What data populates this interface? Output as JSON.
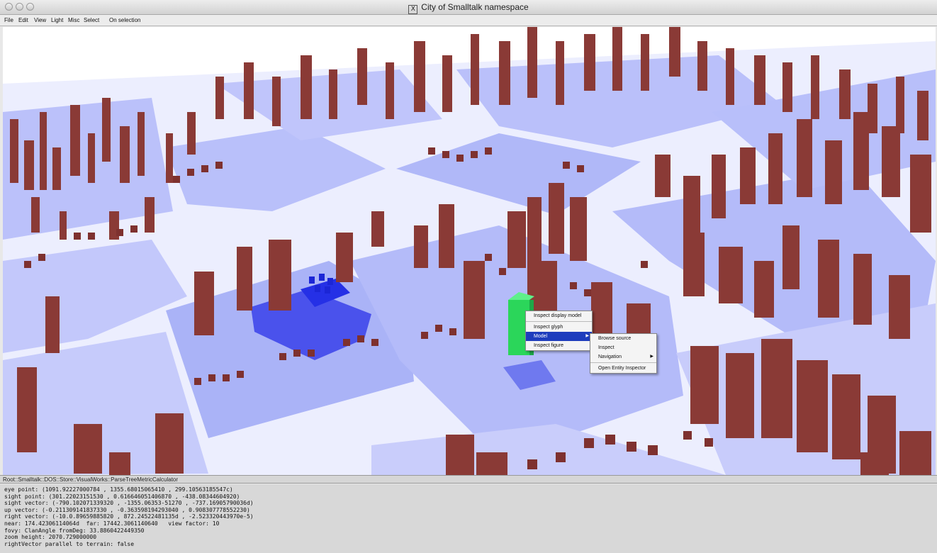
{
  "window": {
    "title": "City of Smalltalk namespace"
  },
  "menubar": [
    "File",
    "Edit",
    "View",
    "Light",
    "Misc",
    "Select",
    "On selection"
  ],
  "colors": {
    "class_building": "#8a3a36",
    "package_district": "#a9b1f5",
    "selected_building": "#2bd65a",
    "selected_district": "#2e35ea",
    "menu_highlight": "#1e3dbd"
  },
  "context_menu": {
    "items": [
      "Inspect display model",
      "Inspect glyph",
      "Model",
      "Inspect figure"
    ],
    "highlighted": "Model"
  },
  "submenu": {
    "items": [
      "Browse source",
      "Inspect",
      "Navigation",
      "Open Entity Inspector"
    ]
  },
  "status_path": "Root::Smalltalk::DOS::Store::VisualWorks::ParseTreeMetricCalculator",
  "console": [
    "eye point: (1091.92227000784 , 1355.68015065410 , 299.10563185547c)",
    "sight point: (301.22023151530 , 0.616646051406870 , -438.08344604920)",
    "sight vector: (-790.102071339320 , -1355.06353-51270 , -737.16905790036d)",
    "up vector: (-0.211309141837330 , -0.363598194293040 , 0.908307778552230)",
    "right vector: (-10.0.89659885820 , 872.24522481135d , -2.523320443970e-5)",
    "near: 174.42306114064d  far: 17442.3061140640   view factor: 10",
    "fovy: ClanAngle fromDeg: 33.8860422449350",
    "zoom height: 2070.729000000",
    "rightVector parallel to terrain: false"
  ]
}
